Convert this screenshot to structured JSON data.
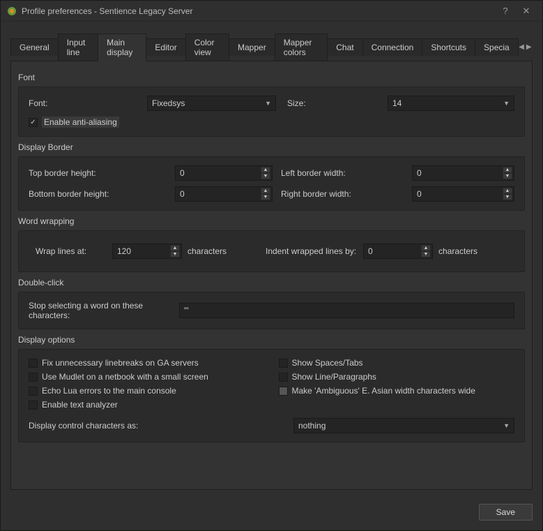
{
  "window": {
    "title": "Profile preferences - Sentience Legacy Server",
    "help": "?",
    "close": "✕"
  },
  "tabs": {
    "items": [
      "General",
      "Input line",
      "Main display",
      "Editor",
      "Color view",
      "Mapper",
      "Mapper colors",
      "Chat",
      "Connection",
      "Shortcuts",
      "Specia"
    ],
    "active_index": 2
  },
  "font_section": {
    "title": "Font",
    "font_label": "Font:",
    "font_value": "Fixedsys",
    "size_label": "Size:",
    "size_value": "14",
    "antialias_label": "Enable anti-aliasing",
    "antialias_checked": true
  },
  "border_section": {
    "title": "Display Border",
    "top_label": "Top border height:",
    "top_value": "0",
    "bottom_label": "Bottom border height:",
    "bottom_value": "0",
    "left_label": "Left border width:",
    "left_value": "0",
    "right_label": "Right border width:",
    "right_value": "0"
  },
  "wrap_section": {
    "title": "Word wrapping",
    "wrap_label": "Wrap lines at:",
    "wrap_value": "120",
    "wrap_unit": "characters",
    "indent_label": "Indent wrapped lines by:",
    "indent_value": "0",
    "indent_unit": "characters"
  },
  "dblclick_section": {
    "title": "Double-click",
    "stop_label": "Stop selecting a word on these characters:",
    "stop_value": "'\""
  },
  "display_options": {
    "title": "Display options",
    "fix_ga": "Fix unnecessary linebreaks on GA servers",
    "netbook": "Use Mudlet on a netbook with a small screen",
    "echo_lua": "Echo Lua errors to the main console",
    "text_analyzer": "Enable text analyzer",
    "show_spaces": "Show Spaces/Tabs",
    "show_lines": "Show Line/Paragraphs",
    "ambiguous": "Make 'Ambiguous' E. Asian width characters wide",
    "control_label": "Display control characters as:",
    "control_value": "nothing"
  },
  "footer": {
    "save": "Save"
  }
}
